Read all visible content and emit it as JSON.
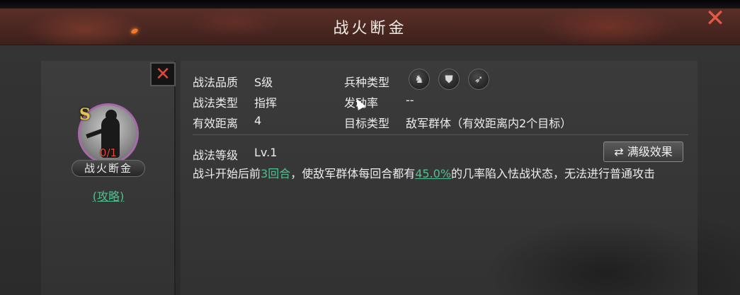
{
  "window": {
    "title": "战火断金"
  },
  "icons": {
    "close": "close-x-icon",
    "remove": "remove-x-icon",
    "swap": "swap-arrows-icon"
  },
  "skill_card": {
    "grade": "S",
    "count": "0/1",
    "name": "战火断金",
    "guide_link": "(攻略)"
  },
  "details": {
    "quality_label": "战法品质",
    "quality_value": "S级",
    "type_label": "战法类型",
    "type_value": "指挥",
    "range_label": "有效距离",
    "range_value": "4",
    "troop_label": "兵种类型",
    "troop_icons": [
      "cavalry-horse-icon",
      "shield-infantry-icon",
      "bow-archer-icon"
    ],
    "rate_label": "发动率",
    "rate_value": "--",
    "target_label": "目标类型",
    "target_value": "敌军群体（有效距离内2个目标）",
    "level_label": "战法等级",
    "level_value": "Lv.1",
    "max_level_button": "满级效果",
    "description": {
      "part1": "战斗开始后前",
      "rounds": "3回合",
      "part2": "，使敌军群体每回合都有",
      "chance": "45.0%",
      "part3": "的几率陷入怯战状态，无法进行普通攻击"
    }
  },
  "colors": {
    "accent_green": "#4fc08f",
    "close_red": "#e25a45",
    "grade_gold": "#e8c24a",
    "avatar_border": "#a66aa8"
  }
}
